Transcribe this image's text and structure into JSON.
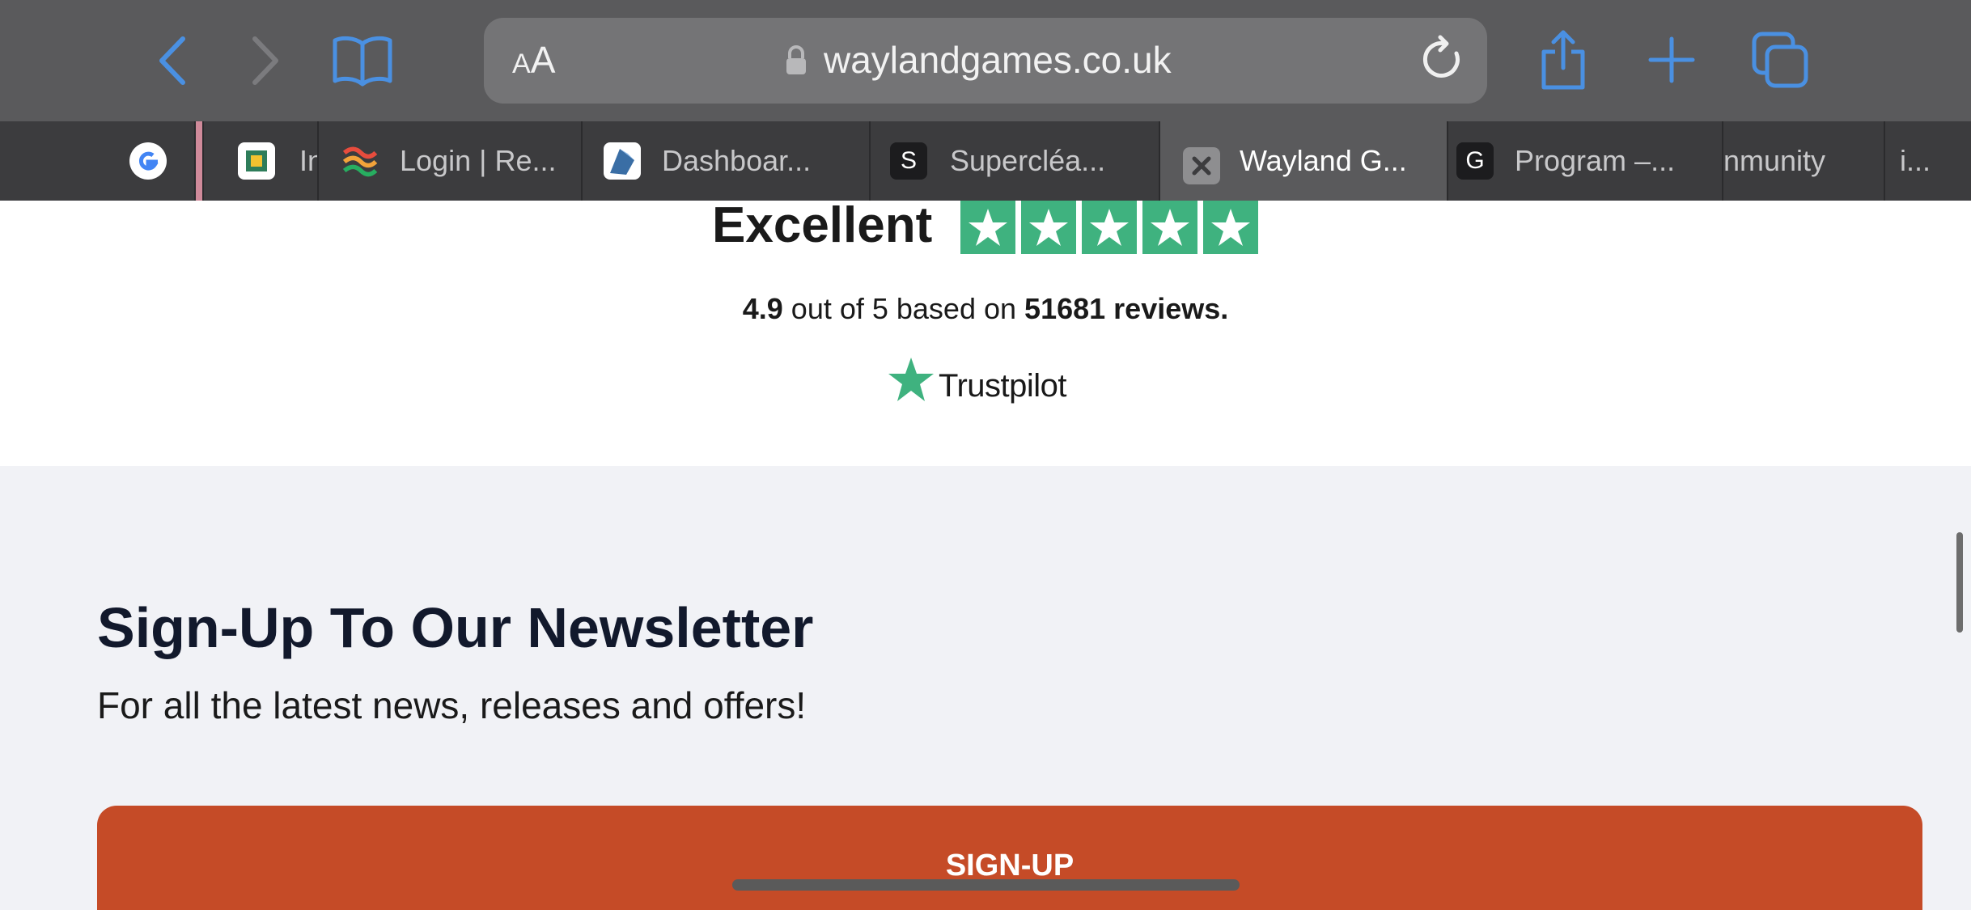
{
  "browser": {
    "url": "waylandgames.co.uk",
    "reader_label_small": "A",
    "reader_label_large": "A",
    "icons": [
      "back-icon",
      "forward-icon",
      "bookmarks-icon",
      "lock-icon",
      "reload-icon",
      "share-icon",
      "new-tab-icon",
      "tabs-overview-icon"
    ],
    "accent_color": "#4a90e2"
  },
  "tabs": [
    {
      "label": "In"
    },
    {
      "label": "Login | Re..."
    },
    {
      "label": "Dashboar..."
    },
    {
      "label": "Supercléa...",
      "favicon_letter": "S"
    },
    {
      "label": "Wayland G...",
      "active": true
    },
    {
      "label": "Program –...",
      "favicon_letter": "G"
    },
    {
      "label": "nmunity"
    },
    {
      "label": "i..."
    }
  ],
  "trustpilot": {
    "verdict": "Excellent",
    "stars": 5,
    "rating": "4.9",
    "rating_mid": "out of 5 based on",
    "reviews": "51681 reviews.",
    "brand": "Trustpilot",
    "star_color": "#3fb27f"
  },
  "newsletter": {
    "title": "Sign-Up To Our Newsletter",
    "subtitle": "For all the latest news, releases and offers!",
    "button_label": "SIGN-UP",
    "button_color": "#c54b27"
  }
}
